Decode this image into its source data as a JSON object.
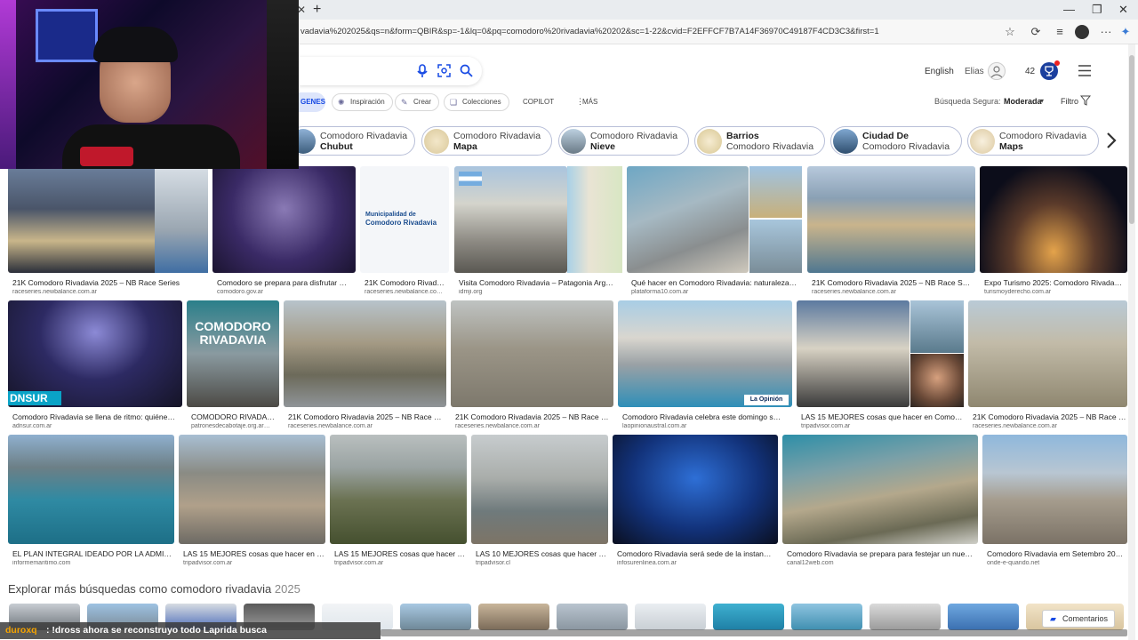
{
  "browser": {
    "new_tab_symbol": "+",
    "close_tab_symbol": "✕",
    "url": "vadavia%202025&qs=n&form=QBIR&sp=-1&lq=0&pq=comodoro%20rivadavia%20202&sc=1-22&cvid=F2EFFCF7B7A14F36970C49187F4CD3C3&first=1",
    "win_min": "—",
    "win_max": "❐",
    "win_close": "✕"
  },
  "header": {
    "language": "English",
    "user_name": "Elias",
    "rewards_points": "42",
    "safe_search_label": "Búsqueda Segura:",
    "safe_search_value": "Moderada",
    "filter_label": "Filtro"
  },
  "filters": {
    "images_tab": "GENES",
    "inspiration": "Inspiración",
    "create": "Crear",
    "collections": "Colecciones",
    "copilot": "COPILOT",
    "more": "MÁS"
  },
  "related": [
    {
      "line1": "Comodoro Rivadavia",
      "line2": "Chubut",
      "bold_line": 2
    },
    {
      "line1": "Comodoro Rivadavia",
      "line2": "Mapa",
      "bold_line": 2
    },
    {
      "line1": "Comodoro Rivadavia",
      "line2": "Nieve",
      "bold_line": 2
    },
    {
      "line1": "Barrios",
      "line2": "Comodoro Rivadavia",
      "bold_line": 1
    },
    {
      "line1": "Ciudad De",
      "line2": "Comodoro Rivadavia",
      "bold_line": 1
    },
    {
      "line1": "Comodoro Rivadavia",
      "line2": "Maps",
      "bold_line": 2
    }
  ],
  "results": [
    {
      "caption": "21K Comodoro Rivadavia 2025 – NB Race Series",
      "source": "raceseries.newbalance.com.ar"
    },
    {
      "caption": "Comodoro se prepara para disfrutar …",
      "source": "comodoro.gov.ar"
    },
    {
      "caption": "21K Comodoro Rivad…",
      "source": "raceseries.newbalance.co…",
      "logo_text_1": "Municipalidad de",
      "logo_text_2": "Comodoro Rivadavia"
    },
    {
      "caption": "Visita Comodoro Rivadavia – Patagonia Arg…",
      "source": "idmji.org"
    },
    {
      "caption": "Qué hacer en Comodoro Rivadavia: naturaleza…",
      "source": "plataforma10.com.ar"
    },
    {
      "caption": "21K Comodoro Rivadavia 2025 – NB Race S…",
      "source": "raceseries.newbalance.com.ar"
    },
    {
      "caption": "Expo Turismo 2025: Comodoro Rivada…",
      "source": "turismoyderecho.com.ar"
    },
    {
      "caption": "Comodoro Rivadavia se llena de ritmo: quiéne…",
      "source": "adnsur.com.ar",
      "overlay": "DNSUR"
    },
    {
      "caption": "COMODORO RIVADA…",
      "source": "patronesdecabotaje.org.ar…",
      "overlay": "COMODORO RIVADAVIA"
    },
    {
      "caption": "21K Comodoro Rivadavia 2025 – NB Race …",
      "source": "raceseries.newbalance.com.ar"
    },
    {
      "caption": "21K Comodoro Rivadavia 2025 – NB Race …",
      "source": "raceseries.newbalance.com.ar"
    },
    {
      "caption": "Comodoro Rivadavia celebra este domingo s…",
      "source": "laopinionaustral.com.ar",
      "overlay": "La Opinión"
    },
    {
      "caption": "LAS 15 MEJORES cosas que hacer en Como…",
      "source": "tripadvisor.com.ar"
    },
    {
      "caption": "21K Comodoro Rivadavia 2025 – NB Race …",
      "source": "raceseries.newbalance.com.ar"
    },
    {
      "caption": "EL PLAN INTEGRAL IDEADO POR LA ADMI…",
      "source": "informemaritimo.com"
    },
    {
      "caption": "LAS 15 MEJORES cosas que hacer en …",
      "source": "tripadvisor.com.ar"
    },
    {
      "caption": "LAS 15 MEJORES cosas que hacer …",
      "source": "tripadvisor.com.ar"
    },
    {
      "caption": "LAS 10 MEJORES cosas que hacer …",
      "source": "tripadvisor.cl"
    },
    {
      "caption": "Comodoro Rivadavia será sede de la instan…",
      "source": "infosurenlinea.com.ar"
    },
    {
      "caption": "Comodoro Rivadavia se prepara para festejar un nue…",
      "source": "canal12web.com"
    },
    {
      "caption": "Comodoro Rivadavia em Setembro 20…",
      "source": "onde-e-quando.net"
    }
  ],
  "explore": {
    "title": "Explorar más búsquedas como comodoro rivadavia",
    "title_year": "2025"
  },
  "feedback_label": "Comentarios",
  "stream_chat": {
    "user": "duroxq",
    "message": ": !dross ahora se reconstruyo todo Laprida busca"
  },
  "colors": {
    "accent": "#174ae4",
    "pill_border": "#b8bfd8",
    "chat_user": "#f5a300"
  }
}
